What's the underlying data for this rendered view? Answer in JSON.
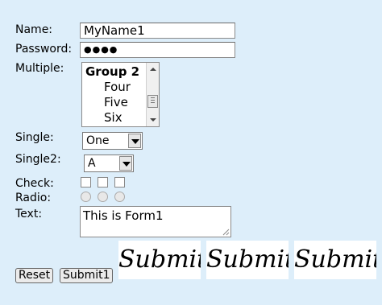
{
  "form": {
    "name": {
      "label": "Name:",
      "value": "MyName1"
    },
    "password": {
      "label": "Password:",
      "value": "●●●●"
    },
    "multiple": {
      "label": "Multiple:",
      "options": [
        "Group 2",
        "Four",
        "Five",
        "Six"
      ]
    },
    "single": {
      "label": "Single:",
      "value": "One"
    },
    "single2": {
      "label": "Single2:",
      "value": "A"
    },
    "check": {
      "label": "Check:",
      "count": 3
    },
    "radio": {
      "label": "Radio:",
      "count": 3
    },
    "text": {
      "label": "Text:",
      "value": "This is Form1"
    },
    "buttons": {
      "reset": "Reset",
      "submit1": "Submit1",
      "image_submits": [
        "Submit",
        "Submit",
        "Submit"
      ]
    }
  },
  "icon_names": [
    "scroll-up-icon",
    "scroll-down-icon",
    "dropdown-arrow-icon",
    "resize-grip-icon"
  ]
}
